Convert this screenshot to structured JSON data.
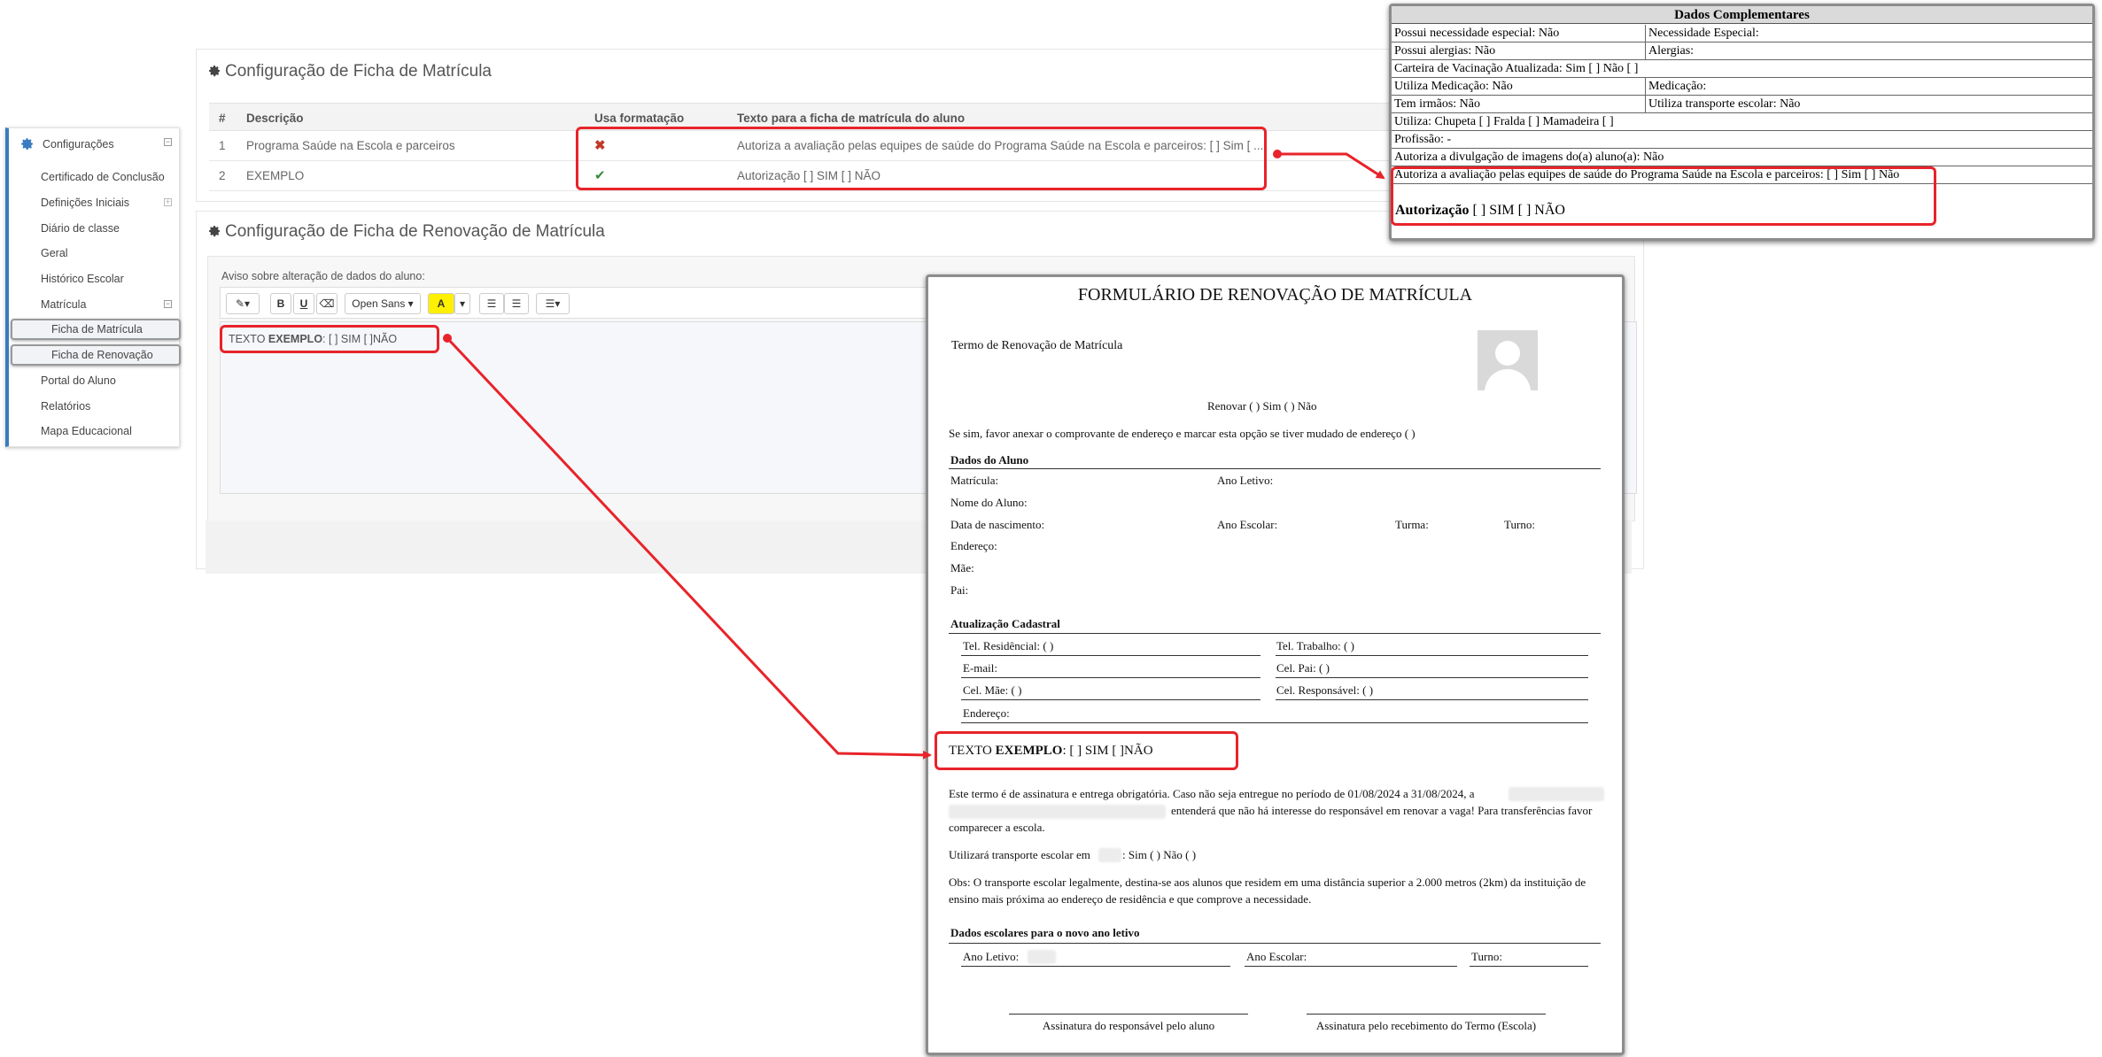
{
  "sidebar": {
    "header": "Configurações",
    "items": [
      "Certificado de Conclusão",
      "Definições Iniciais",
      "Diário de classe",
      "Geral",
      "Histórico Escolar",
      "Matrícula"
    ],
    "subitems": [
      "Ficha de Matrícula",
      "Ficha de Renovação"
    ],
    "items_after": [
      "Portal do Aluno",
      "Relatórios",
      "Mapa Educacional"
    ]
  },
  "ficha_matricula": {
    "title": "Configuração de Ficha de Matrícula",
    "columns": [
      "#",
      "Descrição",
      "Usa formatação",
      "Texto para a ficha de matrícula do aluno"
    ],
    "rows": [
      {
        "num": "1",
        "descricao": "Programa Saúde na Escola e parceiros",
        "usa_formatacao": "no",
        "texto": "Autoriza a avaliação pelas equipes de saúde do Programa Saúde na Escola e parceiros: [ ] Sim [ ..."
      },
      {
        "num": "2",
        "descricao": "EXEMPLO",
        "usa_formatacao": "yes",
        "texto": "Autorização [ ] SIM [ ] NÃO"
      }
    ]
  },
  "ficha_renovacao": {
    "title": "Configuração de Ficha de Renovação de Matrícula",
    "editor_label": "Aviso sobre alteração de dados do aluno:",
    "font_select": "Open Sans",
    "editor_text_normal": "TEXTO ",
    "editor_text_bold": "EXEMPLO",
    "editor_text_rest": ":  [  ] SIM  [  ]NÃO"
  },
  "dados_complementares": {
    "title": "Dados Complementares",
    "rows": [
      [
        "Possui necessidade especial: Não",
        "Necessidade Especial:"
      ],
      [
        "Possui alergias: Não",
        "Alergias:"
      ],
      [
        "Carteira de Vacinação Atualizada: Sim [ ] Não [ ]"
      ],
      [
        "Utiliza Medicação: Não",
        "Medicação:"
      ],
      [
        "Tem irmãos: Não",
        "Utiliza transporte escolar: Não"
      ],
      [
        "Utiliza: Chupeta [ ] Fralda [ ] Mamadeira [ ]"
      ],
      [
        "Profissão:  -"
      ],
      [
        "Autoriza a divulgação de imagens do(a) aluno(a): Não"
      ],
      [
        "Autoriza a avaliação pelas equipes de saúde do Programa Saúde na Escola e parceiros:  [  ] Sim   [  ] Não"
      ]
    ],
    "autorizacao_bold": "Autorização",
    "autorizacao_rest": " [   ] SIM   [   ]  NÃO"
  },
  "formulario": {
    "title": "FORMULÁRIO DE RENOVAÇÃO DE MATRÍCULA",
    "termo": "Termo de Renovação de Matrícula",
    "renovar": "Renovar (    ) Sim   (    ) Não",
    "endereco_note": "Se sim, favor anexar o comprovante de endereço e marcar esta opção se tiver mudado de endereço  (    )",
    "dados_aluno": "Dados do Aluno",
    "matricula": "Matrícula:",
    "ano_letivo": "Ano Letivo:",
    "nome": "Nome do Aluno:",
    "nascimento": "Data de nascimento:",
    "ano_escolar": "Ano Escolar:",
    "turma": "Turma:",
    "turno": "Turno:",
    "endereco": "Endereço:",
    "mae": "Mãe:",
    "pai": "Pai:",
    "atualizacao": "Atualização Cadastral",
    "tel_res": "Tel. Residêncial: (    )",
    "tel_trab": "Tel. Trabalho: (    )",
    "email": "E-mail:",
    "cel_pai": "Cel. Pai: (    )",
    "cel_mae": "Cel. Mãe: (    )",
    "cel_resp": "Cel. Responsável: (    )",
    "endereco2": "Endereço:",
    "texto_normal": "TEXTO ",
    "texto_bold": "EXEMPLO",
    "texto_rest": ":   [   ] SIM   [   ]NÃO",
    "paragraph1_a": "Este termo é de assinatura e entrega obrigatória. Caso não seja entregue no período de 01/08/2024 a 31/08/2024, a",
    "paragraph1_b": "entenderá que não há interesse do responsável em renovar a vaga! Para transferências favor",
    "paragraph1_c": "comparecer a escola.",
    "transporte_a": "Utilizará transporte escolar em",
    "transporte_b": ": Sim  (    ) Não  (    )",
    "obs_a": "Obs: O transporte escolar legalmente, destina-se aos alunos que residem em uma distância superior a 2.000 metros (2km) da instituição de",
    "obs_b": "ensino mais próxima ao endereço de residência e que comprove a necessidade.",
    "dados_escolares": "Dados escolares para o novo ano letivo",
    "ano_letivo2": "Ano Letivo:",
    "ano_escolar2": "Ano Escolar:",
    "turno2": "Turno:",
    "assinatura1": "Assinatura do responsável pelo aluno",
    "assinatura2": "Assinatura pelo recebimento do Termo (Escola)"
  },
  "colors": {
    "accent": "#3a7cc0",
    "highlight": "#e8232a",
    "check": "#3a8a3a",
    "cross": "#c0392b"
  }
}
